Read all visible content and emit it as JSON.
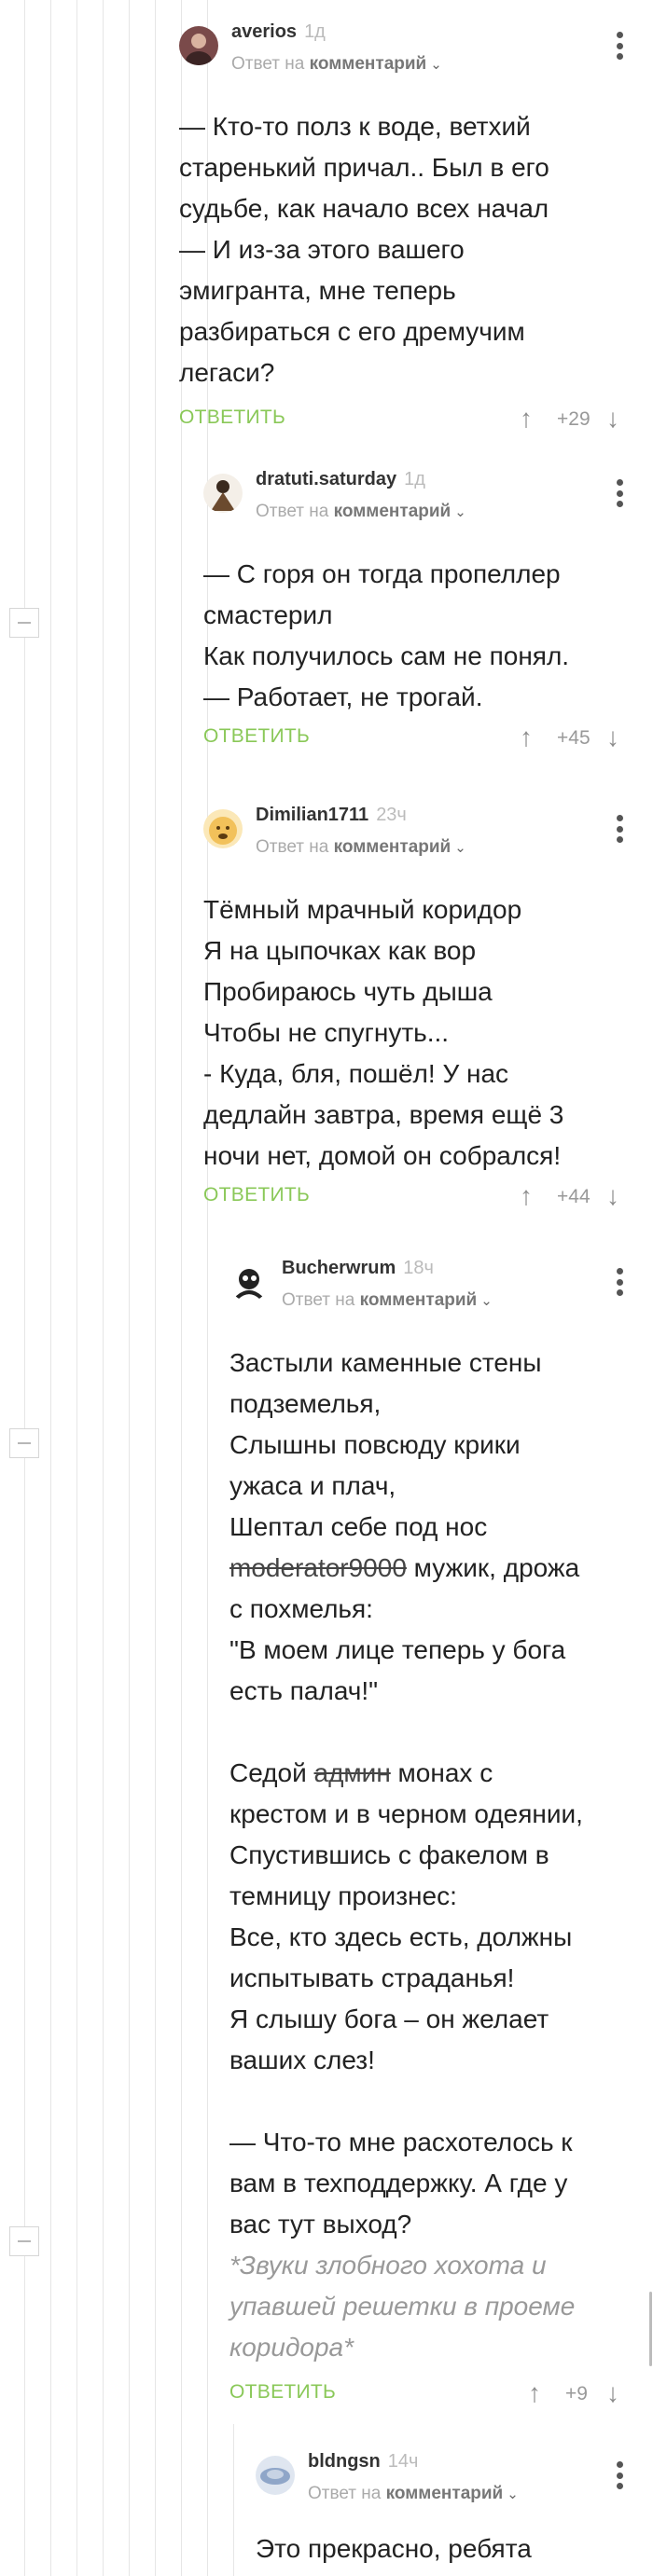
{
  "reply_to_prefix": "Ответ на",
  "reply_to_target": "комментарий",
  "reply_label": "ОТВЕТИТЬ",
  "comments": [
    {
      "author": "averios",
      "time": "1д",
      "avatar_color": "#7a4a4a",
      "text": "— Кто-то полз к воде, ветхий\nстаренький причал.. Был в его\nсудьбе, как начало всех начал\n— И из-за этого вашего\nэмигранта, мне теперь\nразбираться с его дремучим\nлегаси?",
      "score": "+29"
    },
    {
      "author": "dratuti.saturday",
      "time": "1д",
      "avatar_color": "#c9a27a",
      "text": "— С горя он тогда пропеллер\nсмастерил\nКак получилось сам не понял.\n— Работает, не трогай.",
      "score": "+45"
    },
    {
      "author": "Dimilian1711",
      "time": "23ч",
      "avatar_color": "#f2c15a",
      "text": "Тёмный мрачный коридор\nЯ на цыпочках как вор\nПробираюсь чуть дыша\nЧтобы не спугнуть...\n- Куда, бля, пошёл! У нас\nдедлайн завтра, время ещё 3\nночи нет, домой он собрался!",
      "score": "+44"
    },
    {
      "author": "Bucherwrum",
      "time": "18ч",
      "avatar_color": "#222222",
      "text_p1": "Застыли каменные стены\nподземелья,\nСлышны повсюду крики\nужаса и плач,\nШептал себе под нос\n",
      "struck1": "moderator9000",
      "text_p2": " мужик, дрожа\nс похмелья:\n\"В моем лице теперь у бога\nесть палач!\"\n\nСедой ",
      "struck2": "админ",
      "text_p3": " монах с\nкрестом и в черном одеянии,\nСпустившись с факелом в\nтемницу произнес:\nВсе, кто здесь есть, должны\nиспытывать страданья!\nЯ слышу бога – он желает\nваших слез!\n\n— Что-то мне расхотелось к\nвам в техподдержку. А где у\nвас тут выход?\n",
      "italic": "*Звуки злобного хохота и\nупавшей решетки в проеме\nкоридора*",
      "score": "+9"
    },
    {
      "author": "bldngsn",
      "time": "14ч",
      "avatar_color": "#8fa6c8",
      "text": "Это прекрасно, ребята"
    }
  ]
}
